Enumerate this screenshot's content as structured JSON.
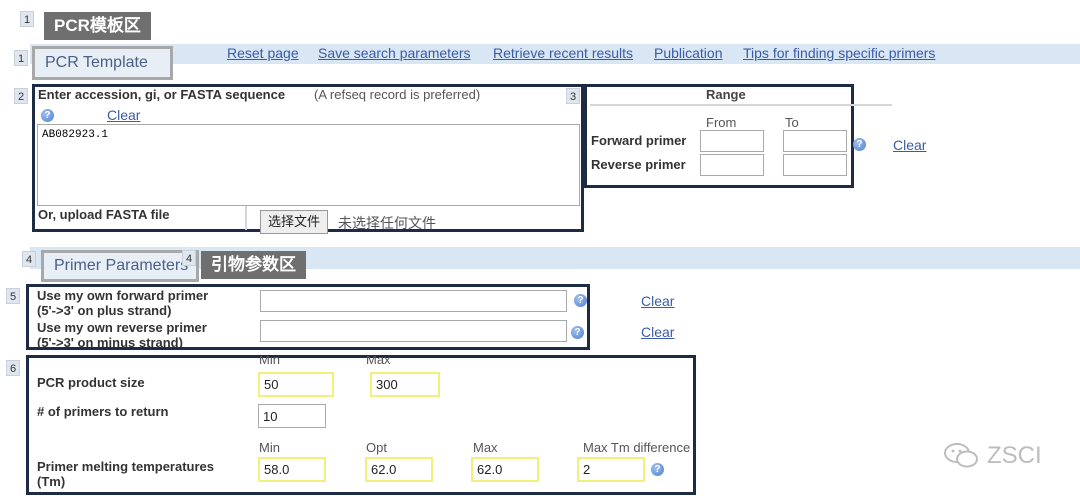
{
  "callouts": {
    "template_area": "PCR模板区",
    "primer_area": "引物参数区"
  },
  "badges": [
    "1",
    "1",
    "2",
    "3",
    "4",
    "4",
    "5",
    "6"
  ],
  "top_links": {
    "reset": "Reset page",
    "save": "Save search parameters",
    "retrieve": "Retrieve recent results",
    "publication": "Publication",
    "tips": "Tips for finding specific primers"
  },
  "tabs": {
    "pcr_template": "PCR Template",
    "primer_parameters": "Primer Parameters"
  },
  "template": {
    "heading": "Enter accession, gi, or FASTA sequence",
    "note": "(A refseq record is preferred)",
    "clear": "Clear",
    "sequence": "AB082923.1",
    "upload_label": "Or, upload FASTA file",
    "file_button": "选择文件",
    "file_status": "未选择任何文件"
  },
  "range": {
    "title": "Range",
    "from": "From",
    "to": "To",
    "forward": "Forward primer",
    "reverse": "Reverse primer",
    "clear": "Clear"
  },
  "own_primers": {
    "forward_label": "Use my own forward primer",
    "forward_sub": "(5'->3' on plus strand)",
    "reverse_label": "Use my own reverse primer",
    "reverse_sub": "(5'->3' on minus strand)",
    "clear": "Clear"
  },
  "params": {
    "min_label": "Min",
    "max_label": "Max",
    "product_size_label": "PCR product size",
    "product_min": "50",
    "product_max": "300",
    "num_primers_label": "# of primers to return",
    "num_primers": "10",
    "tm_label": "Primer melting temperatures",
    "tm_label2": "(Tm)",
    "tm_min_label": "Min",
    "tm_opt_label": "Opt",
    "tm_max_label": "Max",
    "tm_diff_label": "Max Tm difference",
    "tm_min": "58.0",
    "tm_opt": "62.0",
    "tm_max": "62.0",
    "tm_diff": "2"
  },
  "watermark": "ZSCI",
  "icons": {
    "help": "help-icon",
    "wechat": "wechat-icon"
  },
  "colors": {
    "frame": "#1d2b45",
    "callout": "#6f6f6f",
    "link": "#3b5ba5",
    "band": "#d9e6f4",
    "highlight_border": "#f0f07a"
  }
}
